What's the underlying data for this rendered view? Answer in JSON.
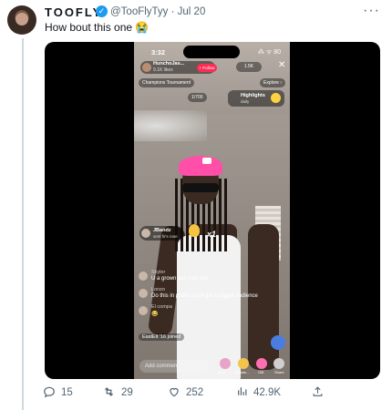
{
  "tweet": {
    "display_name": "TOOFLY",
    "handle_date": "@TooFlyTyy · Jul 20",
    "text": "How bout this one 😭",
    "more_icon": "more-horizontal-icon",
    "verified_icon": "verified-badge-icon"
  },
  "video": {
    "status_time": "3:32",
    "status_signal": "⁂ ᯤ 80",
    "host_name": "HunchoJas...",
    "host_likes": "9.1K likes",
    "follow_label": "+ Follow",
    "viewers": "1.5K",
    "close_symbol": "✕",
    "pill_left": "Champions Tournament",
    "pill_right": "Explore ›",
    "pill_small": "1/700",
    "highlights_title": "Highlights",
    "highlights_sub": "daily",
    "gift_sender": "JBandz",
    "gift_sub": "sent fir's rose",
    "gift_count": "x1",
    "comments": [
      {
        "user": "Skyler",
        "text": "U a grown ass man bro"
      },
      {
        "user": "Lonzo",
        "text": "Do this in public you'll get a bigger audience"
      },
      {
        "user": "El compa",
        "text": "😂"
      }
    ],
    "joined_text": "EastElt '16 joined",
    "add_comment_placeholder": "Add comment...",
    "bottom_labels": [
      "Multi",
      "Beisbe...",
      "Gift",
      "Share"
    ]
  },
  "actions": {
    "replies": "15",
    "retweets": "29",
    "likes": "252",
    "views": "42.9K"
  },
  "colors": {
    "accent_blue": "#1d9bf0",
    "tiktok_red": "#fe2c55",
    "cap_pink": "#ff4fa8"
  }
}
